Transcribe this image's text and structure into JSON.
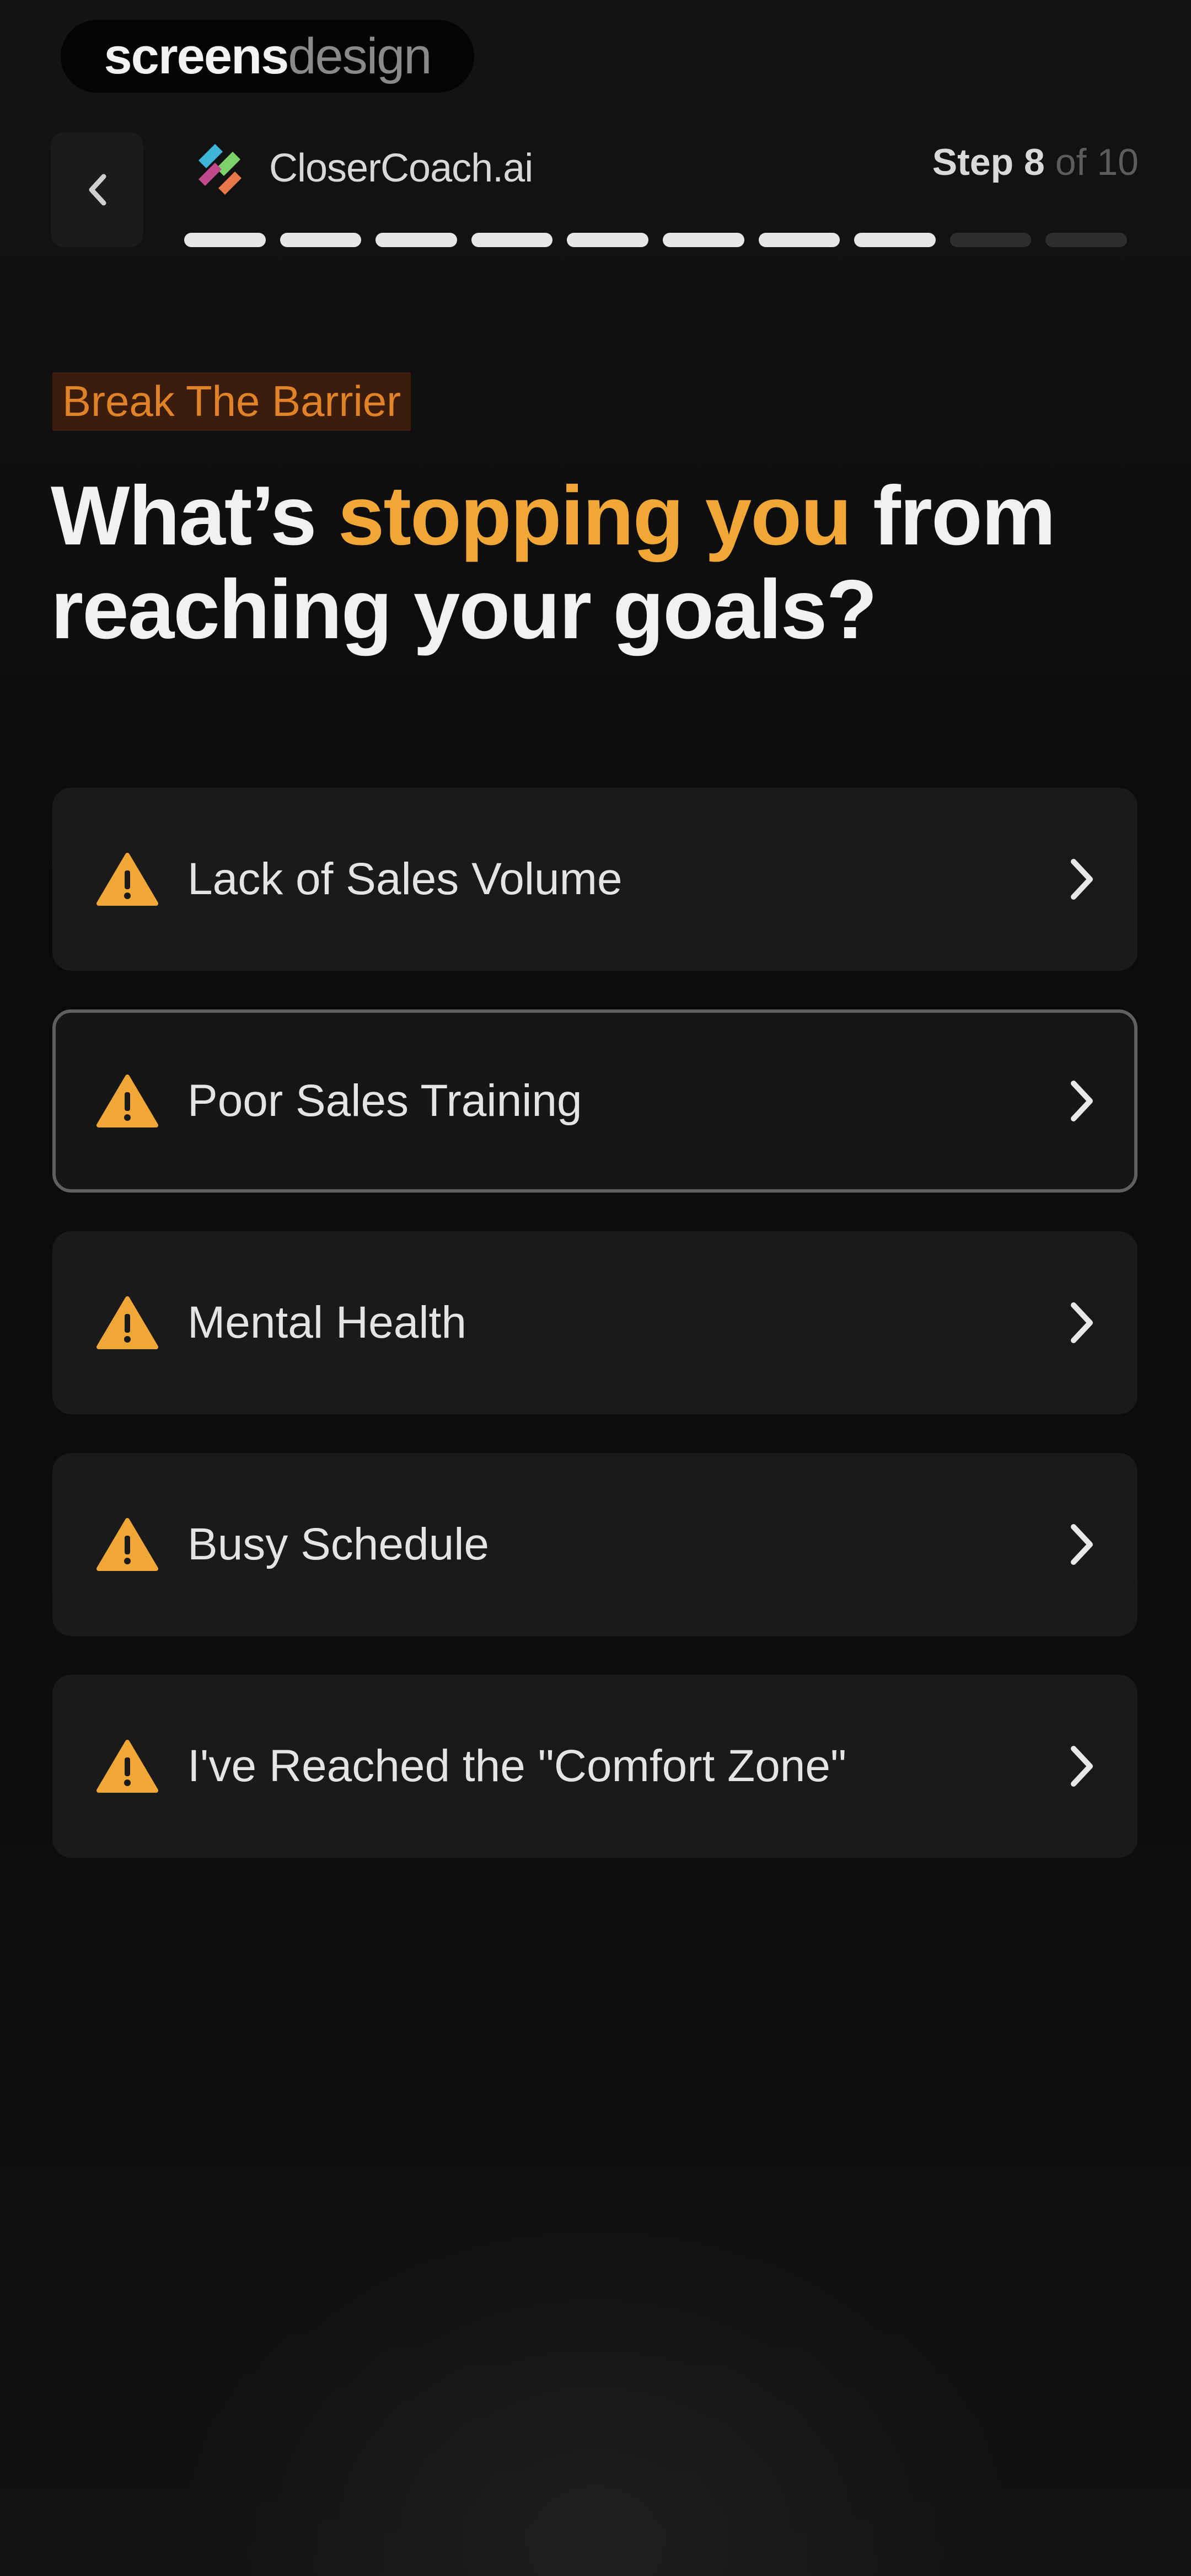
{
  "watermark": {
    "part1": "screens",
    "part2": "design"
  },
  "header": {
    "back_icon": "chevron-left-icon",
    "brand_logo_icon": "closercoach-logo-icon",
    "brand_name": "CloserCoach.ai",
    "step_current_label": "Step 8",
    "step_total_label": "of 10",
    "progress": {
      "current": 8,
      "total": 10
    }
  },
  "content": {
    "eyebrow": "Break The Barrier",
    "headline": {
      "before": "What’s ",
      "accent": "stopping you",
      "after": " from reaching your goals?"
    },
    "options": [
      {
        "label": "Lack of Sales Volume",
        "icon": "warning-icon",
        "selected": false
      },
      {
        "label": "Poor Sales Training",
        "icon": "warning-icon",
        "selected": true
      },
      {
        "label": "Mental Health",
        "icon": "warning-icon",
        "selected": false
      },
      {
        "label": "Busy Schedule",
        "icon": "warning-icon",
        "selected": false
      },
      {
        "label": "I've Reached the \"Comfort Zone\"",
        "icon": "warning-icon",
        "selected": false
      }
    ]
  },
  "colors": {
    "accent": "#f1a736",
    "eyebrow_text": "#e08328",
    "eyebrow_bg": "#3c1c0b",
    "card_bg": "#1a1a1a",
    "selected_border": "#5f5f5f",
    "progress_on": "#e7e7e7",
    "progress_off": "#2e2e2e",
    "warning_fill": "#f1a736"
  }
}
